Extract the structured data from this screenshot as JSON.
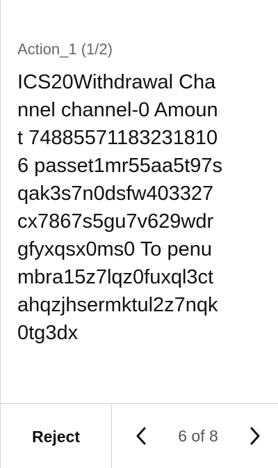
{
  "action": {
    "title": "Action_1 (1/2)",
    "lines": [
      "ICS20Withdrawal Cha",
      "nnel channel-0 Amoun",
      "t 74885571183231810",
      "6 passet1mr55aa5t97s",
      "qak3s7n0dsfw403327",
      "cx7867s5gu7v629wdr",
      "gfyxqsx0ms0 To penu",
      "mbra15z7lqz0fuxql3ct",
      "ahqzjhsermktul2z7nqk",
      "0tg3dx"
    ]
  },
  "footer": {
    "reject_label": "Reject",
    "page_indicator": "6 of 8",
    "prev_icon": "chevron-left-icon",
    "next_icon": "chevron-right-icon"
  }
}
